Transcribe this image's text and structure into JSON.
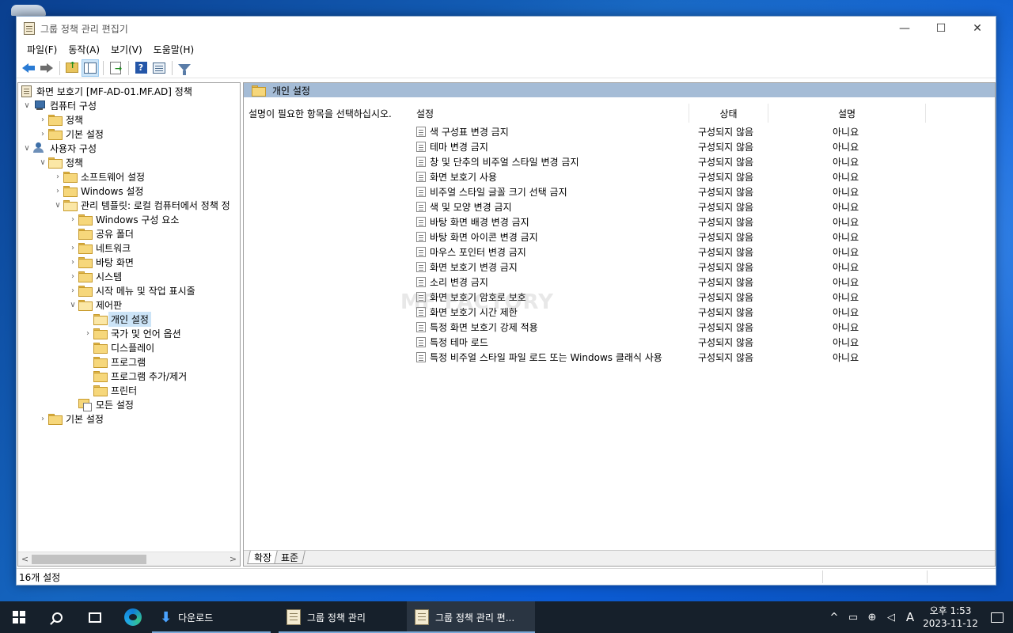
{
  "window": {
    "title": "그룹 정책 관리 편집기",
    "controls": {
      "minimize": "—",
      "maximize": "☐",
      "close": "✕"
    }
  },
  "menu": [
    "파일(F)",
    "동작(A)",
    "보기(V)",
    "도움말(H)"
  ],
  "toolbar": {
    "icons": [
      "back-icon",
      "forward-icon",
      "folder-up-icon",
      "show-hide-tree-icon",
      "export-list-icon",
      "help-icon",
      "properties-icon",
      "filter-icon"
    ]
  },
  "tree": {
    "root": "화면 보호기 [MF-AD-01.MF.AD] 정책",
    "computer": "컴퓨터 구성",
    "computer_policy": "정책",
    "computer_prefs": "기본 설정",
    "user": "사용자 구성",
    "user_policy": "정책",
    "software": "소프트웨어 설정",
    "windows_settings": "Windows 설정",
    "admin_templates": "관리 템플릿: 로컬 컴퓨터에서 정책 정",
    "windows_components": "Windows 구성 요소",
    "shared_folders": "공유 폴더",
    "network": "네트워크",
    "desktop": "바탕 화면",
    "system": "시스템",
    "start_menu": "시작 메뉴 및 작업 표시줄",
    "control_panel": "제어판",
    "personalization": "개인 설정",
    "regional": "국가 및 언어 옵션",
    "display": "디스플레이",
    "programs": "프로그램",
    "add_remove": "프로그램 추가/제거",
    "printers": "프린터",
    "all_settings": "모든 설정",
    "user_prefs": "기본 설정"
  },
  "right": {
    "header": "개인 설정",
    "description": "설명이 필요한 항목을 선택하십시오.",
    "columns": {
      "setting": "설정",
      "state": "상태",
      "comment": "설명"
    },
    "rows": [
      {
        "name": "색 구성표 변경 금지",
        "state": "구성되지 않음",
        "comment": "아니요"
      },
      {
        "name": "테마 변경 금지",
        "state": "구성되지 않음",
        "comment": "아니요"
      },
      {
        "name": "창 및 단추의 비주얼 스타일 변경 금지",
        "state": "구성되지 않음",
        "comment": "아니요"
      },
      {
        "name": "화면 보호기 사용",
        "state": "구성되지 않음",
        "comment": "아니요"
      },
      {
        "name": "비주얼 스타일 글꼴 크기 선택 금지",
        "state": "구성되지 않음",
        "comment": "아니요"
      },
      {
        "name": "색 및 모양 변경 금지",
        "state": "구성되지 않음",
        "comment": "아니요"
      },
      {
        "name": "바탕 화면 배경 변경 금지",
        "state": "구성되지 않음",
        "comment": "아니요"
      },
      {
        "name": "바탕 화면 아이콘 변경 금지",
        "state": "구성되지 않음",
        "comment": "아니요"
      },
      {
        "name": "마우스 포인터 변경 금지",
        "state": "구성되지 않음",
        "comment": "아니요"
      },
      {
        "name": "화면 보호기 변경 금지",
        "state": "구성되지 않음",
        "comment": "아니요"
      },
      {
        "name": "소리 변경 금지",
        "state": "구성되지 않음",
        "comment": "아니요"
      },
      {
        "name": "화면 보호기 암호로 보호",
        "state": "구성되지 않음",
        "comment": "아니요"
      },
      {
        "name": "화면 보호기 시간 제한",
        "state": "구성되지 않음",
        "comment": "아니요"
      },
      {
        "name": "특정 화면 보호기 강제 적용",
        "state": "구성되지 않음",
        "comment": "아니요"
      },
      {
        "name": "특정 테마 로드",
        "state": "구성되지 않음",
        "comment": "아니요"
      },
      {
        "name": "특정 비주얼 스타일 파일 로드 또는 Windows 클래식 사용",
        "state": "구성되지 않음",
        "comment": "아니요"
      }
    ],
    "tabs": [
      "확장",
      "표준"
    ],
    "watermark": "MF FACTORY"
  },
  "status": {
    "text": "16개 설정"
  },
  "taskbar": {
    "apps": [
      {
        "label": "다운로드"
      },
      {
        "label": "그룹 정책 관리"
      },
      {
        "label": "그룹 정책 관리 편..."
      }
    ],
    "tray": {
      "chevron": "^",
      "ime": "A"
    },
    "clock": {
      "time": "오후 1:53",
      "date": "2023-11-12"
    }
  }
}
